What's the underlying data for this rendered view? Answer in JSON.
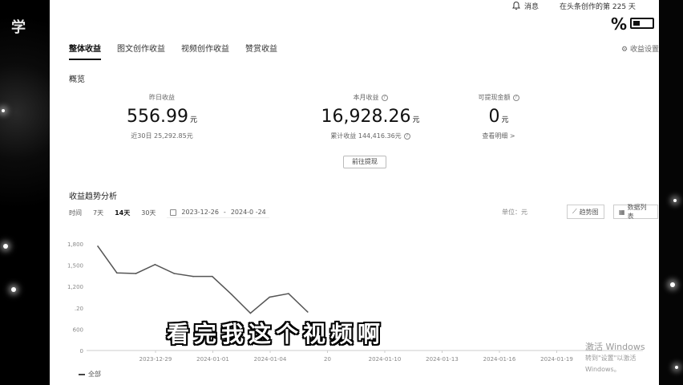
{
  "brand_overlay": "学",
  "topbar": {
    "messages": "消息",
    "creator_days": "在头条创作的第 225 天",
    "battery_percent": "%"
  },
  "tabs": [
    "整体收益",
    "图文创作收益",
    "视频创作收益",
    "赞赏收益"
  ],
  "settings_link": "收益设置",
  "overview": {
    "title": "概览",
    "yesterday": {
      "label": "昨日收益",
      "value": "556.99",
      "unit": "元",
      "sub": "近30日 25,292.85元"
    },
    "month": {
      "label": "本月收益",
      "value": "16,928.26",
      "unit": "元",
      "sub": "累计收益 144,416.36元"
    },
    "withdrawable": {
      "label": "可提现金额",
      "value": "0",
      "unit": "元",
      "sub": "查看明细 >"
    },
    "withdraw_button": "前往提现"
  },
  "trend": {
    "title": "收益趋势分析",
    "time_label": "时间",
    "ranges": [
      "7天",
      "14天",
      "30天"
    ],
    "active_range": "14天",
    "date_start": "2023-12-26",
    "date_sep": "-",
    "date_end": "2024-0 -24",
    "unit_label": "单位：元",
    "view_trend": "趋势图",
    "view_table": "数据列表"
  },
  "chart_data": {
    "type": "line",
    "x": [
      "2023-12-26",
      "2023-12-27",
      "2023-12-28",
      "2023-12-29",
      "2023-12-30",
      "2023-12-31",
      "2024-01-01",
      "2024-01-02",
      "2024-01-03",
      "2024-01-04",
      "2024-01-05"
    ],
    "x_tick_labels": [
      "2023-12-29",
      "2024-01-01",
      "2024-01-04",
      "20",
      "2024-01-10",
      "2024-01-13",
      "2024-01-16",
      "2024-01-19"
    ],
    "y_tick_labels": [
      "1,800",
      "1,500",
      "1,200",
      ".20",
      "600",
      "0"
    ],
    "ylim": [
      0,
      1800
    ],
    "series": [
      {
        "name": "全部",
        "values": [
          1760,
          1310,
          1300,
          1450,
          1300,
          1250,
          1250,
          950,
          630,
          900,
          960,
          650
        ]
      }
    ],
    "grid": false,
    "legend": "bottom-left"
  },
  "subtitle_overlay": "看完我这个视频啊",
  "watermark": {
    "line1": "激活 Windows",
    "line2": "转到\"设置\"以激活 Windows。"
  },
  "colors": {
    "line": "#555555",
    "accent": "#111111"
  }
}
